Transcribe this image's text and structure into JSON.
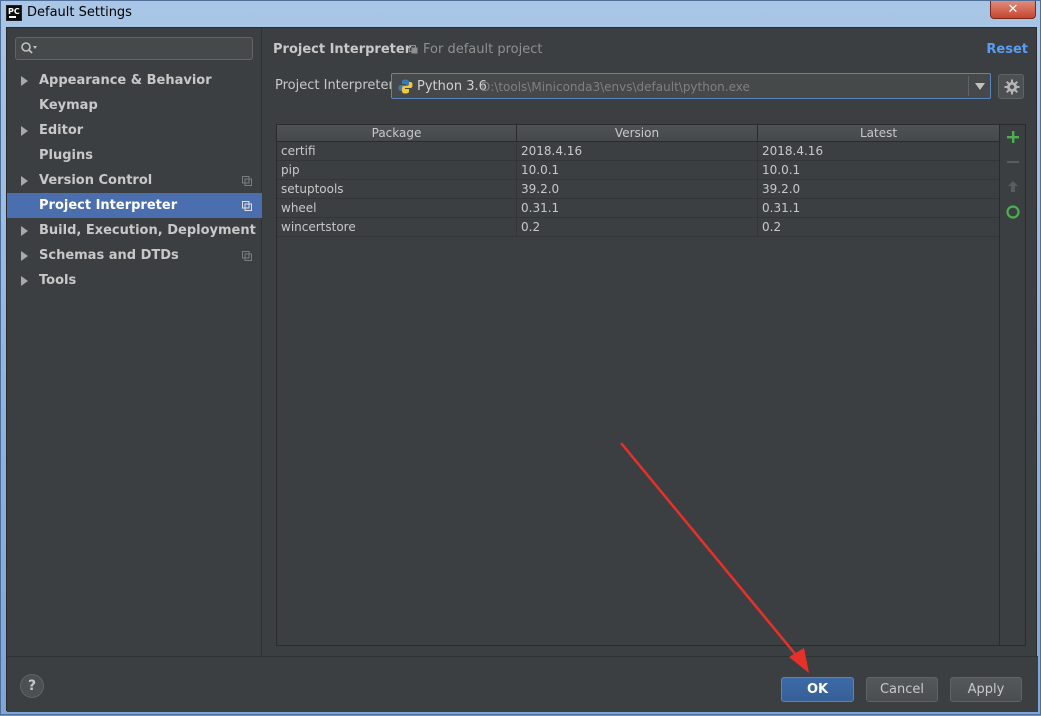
{
  "window": {
    "title": "Default Settings",
    "app_icon_text": "PC",
    "close_glyph": "✕"
  },
  "sidebar": {
    "search_placeholder": "",
    "items": [
      {
        "label": "Appearance & Behavior",
        "expandable": true,
        "copy_icon": false,
        "selected": false
      },
      {
        "label": "Keymap",
        "expandable": false,
        "copy_icon": false,
        "selected": false
      },
      {
        "label": "Editor",
        "expandable": true,
        "copy_icon": false,
        "selected": false
      },
      {
        "label": "Plugins",
        "expandable": false,
        "copy_icon": false,
        "selected": false
      },
      {
        "label": "Version Control",
        "expandable": true,
        "copy_icon": true,
        "selected": false
      },
      {
        "label": "Project Interpreter",
        "expandable": false,
        "copy_icon": true,
        "selected": true
      },
      {
        "label": "Build, Execution, Deployment",
        "expandable": true,
        "copy_icon": false,
        "selected": false
      },
      {
        "label": "Schemas and DTDs",
        "expandable": true,
        "copy_icon": true,
        "selected": false
      },
      {
        "label": "Tools",
        "expandable": true,
        "copy_icon": false,
        "selected": false
      }
    ]
  },
  "header": {
    "title": "Project Interpreter",
    "scope": "For default project",
    "reset_label": "Reset"
  },
  "interpreter": {
    "label": "Project Interpreter:",
    "version": "Python 3.6",
    "path": "D:\\tools\\Miniconda3\\envs\\default\\python.exe"
  },
  "table": {
    "columns": [
      "Package",
      "Version",
      "Latest"
    ],
    "rows": [
      [
        "certifi",
        "2018.4.16",
        "2018.4.16"
      ],
      [
        "pip",
        "10.0.1",
        "10.0.1"
      ],
      [
        "setuptools",
        "39.2.0",
        "39.2.0"
      ],
      [
        "wheel",
        "0.31.1",
        "0.31.1"
      ],
      [
        "wincertstore",
        "0.2",
        "0.2"
      ]
    ]
  },
  "buttons": {
    "help": "?",
    "ok": "OK",
    "cancel": "Cancel",
    "apply": "Apply"
  },
  "colors": {
    "background": "#3c3f41",
    "selection": "#4b6eaf",
    "link": "#589df6",
    "add_icon": "#4caf50",
    "annotation_arrow": "#e8302a"
  }
}
